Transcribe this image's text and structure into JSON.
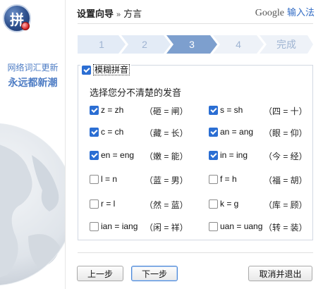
{
  "brand": {
    "logo_char": "拼",
    "google": "Google",
    "ime": "输入法"
  },
  "left": {
    "slogan_line1": "网络词汇更新",
    "slogan_line2": "永远都新潮"
  },
  "header": {
    "wizard": "设置向导",
    "separator": "»",
    "page": "方言"
  },
  "steps": [
    {
      "label": "1",
      "state": "done"
    },
    {
      "label": "2",
      "state": "done"
    },
    {
      "label": "3",
      "state": "active"
    },
    {
      "label": "4",
      "state": "todo"
    },
    {
      "label": "完成",
      "state": "todo"
    }
  ],
  "fuzzy": {
    "label": "模糊拼音",
    "checked": true,
    "instruction": "选择您分不清楚的发音",
    "options": [
      {
        "rule": "z = zh",
        "example": "（砸 = 闸）",
        "checked": true
      },
      {
        "rule": "s = sh",
        "example": "（四 = 十）",
        "checked": true
      },
      {
        "rule": "c = ch",
        "example": "（藏 = 长）",
        "checked": true
      },
      {
        "rule": "an = ang",
        "example": "（眼 = 仰）",
        "checked": true
      },
      {
        "rule": "en = eng",
        "example": "（嫩 = 能）",
        "checked": true
      },
      {
        "rule": "in = ing",
        "example": "（今 = 经）",
        "checked": true
      },
      {
        "rule": "l = n",
        "example": "（蓝 = 男）",
        "checked": false
      },
      {
        "rule": "f = h",
        "example": "（福 = 胡）",
        "checked": false
      },
      {
        "rule": "r = l",
        "example": "（然 = 蓝）",
        "checked": false
      },
      {
        "rule": "k = g",
        "example": "（库 = 顾）",
        "checked": false
      },
      {
        "rule": "ian = iang",
        "example": "（闲 = 祥）",
        "checked": false
      },
      {
        "rule": "uan = uang",
        "example": "（转 = 装）",
        "checked": false
      }
    ]
  },
  "buttons": {
    "prev": "上一步",
    "next": "下一步",
    "cancel": "取消并退出"
  },
  "colors": {
    "accent": "#2b6ed3",
    "step_done": "#e3ebf6",
    "step_active": "#7d9fce",
    "step_todo": "#eef2f8"
  }
}
